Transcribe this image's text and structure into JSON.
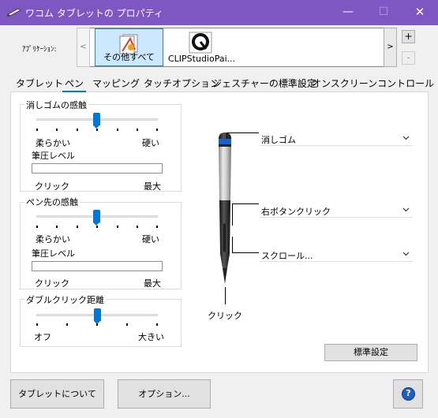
{
  "window": {
    "title": "ワコム タブレットの プロパティ",
    "minimize_glyph": "—",
    "maximize_glyph": "☐",
    "close_glyph": "✕"
  },
  "applications": {
    "label": "ｱﾌﾟﾘｹｰｼｮﾝ:",
    "scroll_left": "<",
    "scroll_right": ">",
    "add": "+",
    "remove": "-",
    "items": [
      {
        "label": "その他すべて",
        "icon": "all-apps-icon",
        "selected": true
      },
      {
        "label": "CLIPStudioPai...",
        "icon": "clip-studio-icon",
        "selected": false
      }
    ]
  },
  "tabs": [
    {
      "label": "タブレット",
      "active": false
    },
    {
      "label": "ペン",
      "active": true
    },
    {
      "label": "マッピング",
      "active": false
    },
    {
      "label": "タッチオプション",
      "active": false
    },
    {
      "label": "ジェスチャーの標準設定",
      "active": false
    },
    {
      "label": "オンスクリーンコントロール",
      "active": false
    }
  ],
  "eraser_feel": {
    "title": "消しゴムの感触",
    "soft": "柔らかい",
    "firm": "硬い",
    "pressure_label": "筆圧レベル",
    "click": "クリック",
    "max": "最大",
    "slider_fraction": 0.5,
    "pressure_fraction": 0
  },
  "tip_feel": {
    "title": "ペン先の感触",
    "soft": "柔らかい",
    "firm": "硬い",
    "pressure_label": "筆圧レベル",
    "click": "クリック",
    "max": "最大",
    "slider_fraction": 0.5,
    "pressure_fraction": 0
  },
  "double_click": {
    "title": "ダブルクリック距離",
    "off": "オフ",
    "large": "大きい",
    "slider_fraction": 0.5
  },
  "pen_buttons": {
    "eraser": "消しゴム",
    "upper_button": "右ボタンクリック",
    "lower_button": "スクロール...",
    "tip": "クリック"
  },
  "buttons": {
    "defaults": "標準設定",
    "about": "タブレットについて",
    "options": "オプション...",
    "help": "?"
  },
  "colors": {
    "titlebar": "#7f57c2",
    "accent": "#0078d7",
    "selection": "#cce8ff"
  }
}
